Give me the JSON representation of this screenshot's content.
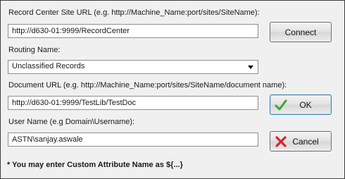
{
  "form": {
    "site_url_label": "Record Center Site URL (e.g. http://Machine_Name:port/sites/SiteName):",
    "site_url_value": "http://d630-01:9999/RecordCenter",
    "routing_label": "Routing Name:",
    "routing_value": "Unclassified Records",
    "document_url_label": "Document URL (e.g. http://Machine_Name:port/sites/SiteName/document name):",
    "document_url_value": "http://d630-01:9999/TestLib/TestDoc",
    "username_label": "User Name (e.g Domain\\Username):",
    "username_value": "ASTN\\sanjay.aswale"
  },
  "buttons": {
    "connect_label": "Connect",
    "ok_label": "OK",
    "cancel_label": "Cancel"
  },
  "icons": {
    "ok": "green-checkmark-icon",
    "cancel": "red-x-icon",
    "dropdown": "chevron-down-icon"
  },
  "colors": {
    "ok_icon": "#3fa531",
    "cancel_icon": "#d8262a"
  },
  "note": "* You may enter Custom Attribute Name as ${...}"
}
